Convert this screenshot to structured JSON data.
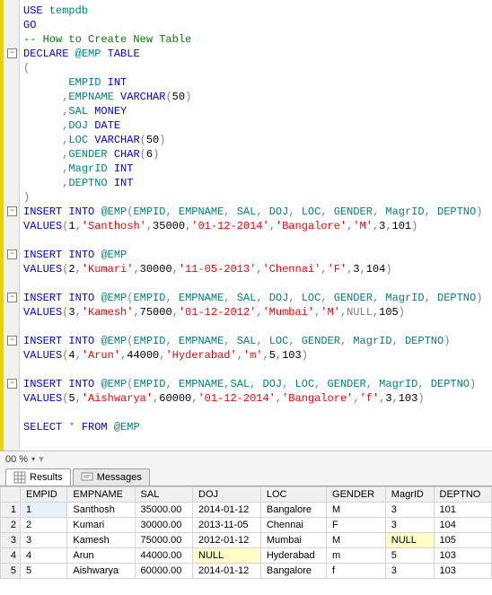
{
  "code_lines": [
    "<span class='kw'>USE</span> <span class='var'>tempdb</span>",
    "<span class='kw'>GO</span>",
    "<span class='comment'>-- How to Create New Table</span>",
    "<span class='kw'>DECLARE</span> <span class='var'>@EMP</span> <span class='kw'>TABLE</span>",
    "<span class='gray'>(</span>",
    "       <span class='var'>EMPID</span> <span class='kw'>INT</span>",
    "      <span class='gray'>,</span><span class='var'>EMPNAME</span> <span class='kw'>VARCHAR</span><span class='gray'>(</span>50<span class='gray'>)</span>",
    "      <span class='gray'>,</span><span class='var'>SAL</span> <span class='kw'>MONEY</span>",
    "      <span class='gray'>,</span><span class='var'>DOJ</span> <span class='kw'>DATE</span>",
    "      <span class='gray'>,</span><span class='var'>LOC</span> <span class='kw'>VARCHAR</span><span class='gray'>(</span>50<span class='gray'>)</span>",
    "      <span class='gray'>,</span><span class='var'>GENDER</span> <span class='kw'>CHAR</span><span class='gray'>(</span>6<span class='gray'>)</span>",
    "      <span class='gray'>,</span><span class='var'>MagrID</span> <span class='kw'>INT</span>",
    "      <span class='gray'>,</span><span class='var'>DEPTNO</span> <span class='kw'>INT</span>",
    "<span class='gray'>)</span>",
    "<span class='kw'>INSERT</span> <span class='kw'>INTO</span> <span class='var'>@EMP</span><span class='gray'>(</span><span class='var'>EMPID</span><span class='gray'>,</span> <span class='var'>EMPNAME</span><span class='gray'>,</span> <span class='var'>SAL</span><span class='gray'>,</span> <span class='var'>DOJ</span><span class='gray'>,</span> <span class='var'>LOC</span><span class='gray'>,</span> <span class='var'>GENDER</span><span class='gray'>,</span> <span class='var'>MagrID</span><span class='gray'>,</span> <span class='var'>DEPTNO</span><span class='gray'>)</span>",
    "<span class='kw'>VALUES</span><span class='gray'>(</span>1<span class='gray'>,</span><span class='str'>'Santhosh'</span><span class='gray'>,</span>35000<span class='gray'>,</span><span class='str'>'01-12-2014'</span><span class='gray'>,</span><span class='str'>'Bangalore'</span><span class='gray'>,</span><span class='str'>'M'</span><span class='gray'>,</span>3<span class='gray'>,</span>101<span class='gray'>)</span>",
    "",
    "<span class='kw'>INSERT</span> <span class='kw'>INTO</span> <span class='var'>@EMP</span>",
    "<span class='kw'>VALUES</span><span class='gray'>(</span>2<span class='gray'>,</span><span class='str'>'Kumari'</span><span class='gray'>,</span>30000<span class='gray'>,</span><span class='str'>'11-05-2013'</span><span class='gray'>,</span><span class='str'>'Chennai'</span><span class='gray'>,</span><span class='str'>'F'</span><span class='gray'>,</span>3<span class='gray'>,</span>104<span class='gray'>)</span>",
    "",
    "<span class='kw'>INSERT</span> <span class='kw'>INTO</span> <span class='var'>@EMP</span><span class='gray'>(</span><span class='var'>EMPID</span><span class='gray'>,</span> <span class='var'>EMPNAME</span><span class='gray'>,</span> <span class='var'>SAL</span><span class='gray'>,</span> <span class='var'>DOJ</span><span class='gray'>,</span> <span class='var'>LOC</span><span class='gray'>,</span> <span class='var'>GENDER</span><span class='gray'>,</span> <span class='var'>MagrID</span><span class='gray'>,</span> <span class='var'>DEPTNO</span><span class='gray'>)</span>",
    "<span class='kw'>VALUES</span><span class='gray'>(</span>3<span class='gray'>,</span><span class='str'>'Kamesh'</span><span class='gray'>,</span>75000<span class='gray'>,</span><span class='str'>'01-12-2012'</span><span class='gray'>,</span><span class='str'>'Mumbai'</span><span class='gray'>,</span><span class='str'>'M'</span><span class='gray'>,</span><span class='gray'>NULL,</span>105<span class='gray'>)</span>",
    "",
    "<span class='kw'>INSERT</span> <span class='kw'>INTO</span> <span class='var'>@EMP</span><span class='gray'>(</span><span class='var'>EMPID</span><span class='gray'>,</span> <span class='var'>EMPNAME</span><span class='gray'>,</span> <span class='var'>SAL</span><span class='gray'>,</span> <span class='var'>LOC</span><span class='gray'>,</span> <span class='var'>GENDER</span><span class='gray'>,</span> <span class='var'>MagrID</span><span class='gray'>,</span> <span class='var'>DEPTNO</span><span class='gray'>)</span>",
    "<span class='kw'>VALUES</span><span class='gray'>(</span>4<span class='gray'>,</span><span class='str'>'Arun'</span><span class='gray'>,</span>44000<span class='gray'>,</span><span class='str'>'Hyderabad'</span><span class='gray'>,</span><span class='str'>'m'</span><span class='gray'>,</span>5<span class='gray'>,</span>103<span class='gray'>)</span>",
    "",
    "<span class='kw'>INSERT</span> <span class='kw'>INTO</span> <span class='var'>@EMP</span><span class='gray'>(</span><span class='var'>EMPID</span><span class='gray'>,</span> <span class='var'>EMPNAME</span><span class='gray'>,</span><span class='var'>SAL</span><span class='gray'>,</span> <span class='var'>DOJ</span><span class='gray'>,</span> <span class='var'>LOC</span><span class='gray'>,</span> <span class='var'>GENDER</span><span class='gray'>,</span> <span class='var'>MagrID</span><span class='gray'>,</span> <span class='var'>DEPTNO</span><span class='gray'>)</span>",
    "<span class='kw'>VALUES</span><span class='gray'>(</span>5<span class='gray'>,</span><span class='str'>'Aishwarya'</span><span class='gray'>,</span>60000<span class='gray'>,</span><span class='str'>'01-12-2014'</span><span class='gray'>,</span><span class='str'>'Bangalore'</span><span class='gray'>,</span><span class='str'>'f'</span><span class='gray'>,</span>3<span class='gray'>,</span>103<span class='gray'>)</span>",
    "",
    "<span class='kw'>SELECT</span> <span class='gray'>*</span> <span class='kw'>FROM</span> <span class='var'>@EMP</span>",
    ""
  ],
  "outline_marks": [
    3,
    14,
    17,
    20,
    23,
    26
  ],
  "zoom": {
    "value": "00 %",
    "dropdown_icon": "▾"
  },
  "tabs": {
    "results": "Results",
    "messages": "Messages"
  },
  "grid": {
    "headers": [
      "EMPID",
      "EMPNAME",
      "SAL",
      "DOJ",
      "LOC",
      "GENDER",
      "MagrID",
      "DEPTNO"
    ],
    "rows": [
      {
        "n": "1",
        "cells": [
          "1",
          "Santhosh",
          "35000.00",
          "2014-01-12",
          "Bangalore",
          "M",
          "3",
          "101"
        ],
        "null_idx": [],
        "sel": true
      },
      {
        "n": "2",
        "cells": [
          "2",
          "Kumari",
          "30000.00",
          "2013-11-05",
          "Chennai",
          "F",
          "3",
          "104"
        ],
        "null_idx": []
      },
      {
        "n": "3",
        "cells": [
          "3",
          "Kamesh",
          "75000.00",
          "2012-01-12",
          "Mumbai",
          "M",
          "NULL",
          "105"
        ],
        "null_idx": [
          6
        ]
      },
      {
        "n": "4",
        "cells": [
          "4",
          "Arun",
          "44000.00",
          "NULL",
          "Hyderabad",
          "m",
          "5",
          "103"
        ],
        "null_idx": [
          3
        ]
      },
      {
        "n": "5",
        "cells": [
          "5",
          "Aishwarya",
          "60000.00",
          "2014-01-12",
          "Bangalore",
          "f",
          "3",
          "103"
        ],
        "null_idx": []
      }
    ]
  }
}
